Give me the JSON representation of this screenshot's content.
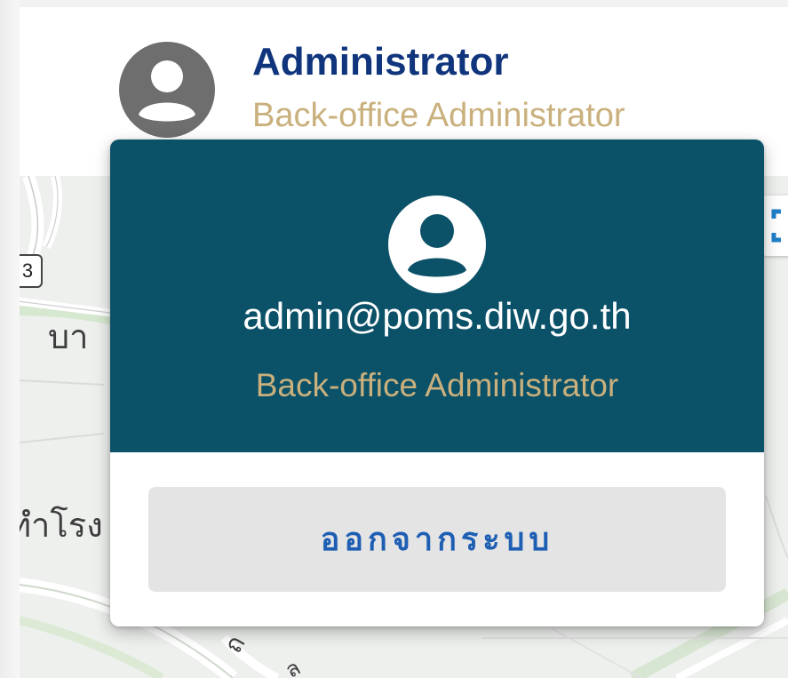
{
  "header": {
    "user_name": "Administrator",
    "user_role": "Back-office Administrator"
  },
  "map": {
    "labels": {
      "road_shield": "3",
      "place_1": "บา",
      "place_2": "ทำโรง",
      "road_1": "ถ",
      "road_2": "ล"
    }
  },
  "profile_menu": {
    "email": "admin@poms.diw.go.th",
    "role": "Back-office Administrator",
    "logout_label": "ออกจากระบบ"
  },
  "colors": {
    "header_name": "#10357d",
    "role_gold": "#c9b07d",
    "card_header_bg": "#0b5168",
    "logout_text": "#1e5fb4",
    "logout_bg": "#e4e4e4"
  },
  "icons": {
    "header_avatar": "account-circle-icon",
    "card_avatar": "account-circle-icon",
    "fullscreen": "fullscreen-icon"
  }
}
